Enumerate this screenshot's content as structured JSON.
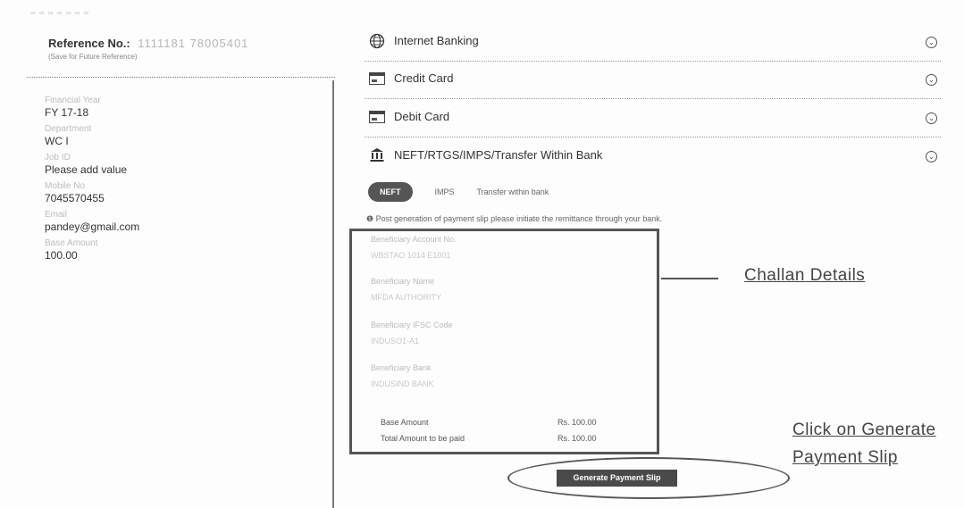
{
  "top_note": "∞ ∞ ∞ ∞ ∞ ∞ ∞",
  "reference": {
    "label": "Reference No.:",
    "value": "1111181 78005401",
    "note": "(Save for Future Reference)"
  },
  "fields": [
    {
      "label": "Financial Year",
      "value": "FY 17-18"
    },
    {
      "label": "Department",
      "value": "WC I"
    },
    {
      "label": "Job ID",
      "value": "Please add value"
    },
    {
      "label": "Mobile No",
      "value": "7045570455"
    },
    {
      "label": "Email",
      "value": "pandey@gmail.com"
    },
    {
      "label": "Base Amount",
      "value": "100.00"
    }
  ],
  "payment_methods": [
    {
      "title": "Internet Banking",
      "icon": "globe-icon"
    },
    {
      "title": "Credit Card",
      "icon": "credit-card-icon"
    },
    {
      "title": "Debit Card",
      "icon": "debit-card-icon"
    },
    {
      "title": "NEFT/RTGS/IMPS/Transfer Within Bank",
      "icon": "bank-transfer-icon"
    }
  ],
  "tabs": {
    "active": "NEFT",
    "others": [
      "IMPS",
      "Transfer within bank"
    ]
  },
  "info_text": "Post generation of payment slip please initiate the remittance through your bank.",
  "challan": {
    "beneficiary_account_label": "Beneficiary Account No.",
    "beneficiary_account_value": "WBSTAO 1014 E1001",
    "beneficiary_name_label": "Beneficiary Name",
    "beneficiary_name_value": "MFDA AUTHORITY",
    "beneficiary_ifsc_label": "Beneficiary IFSC Code",
    "beneficiary_ifsc_value": "INDUSO1-A1",
    "beneficiary_bank_label": "Beneficiary Bank",
    "beneficiary_bank_value": "INDUSIND BANK",
    "base_amount_label": "Base Amount",
    "base_amount_value": "Rs. 100.00",
    "total_amount_label": "Total Amount to be paid",
    "total_amount_value": "Rs. 100.00"
  },
  "generate_button": "Generate Payment Slip",
  "annotations": {
    "challan_details": "Challan Details",
    "click_generate_line1": "Click on Generate",
    "click_generate_line2": "Payment Slip"
  },
  "colors": {
    "active_tab": "#555555",
    "button": "#4a4a4a",
    "muted_text": "#bbbbbb"
  }
}
